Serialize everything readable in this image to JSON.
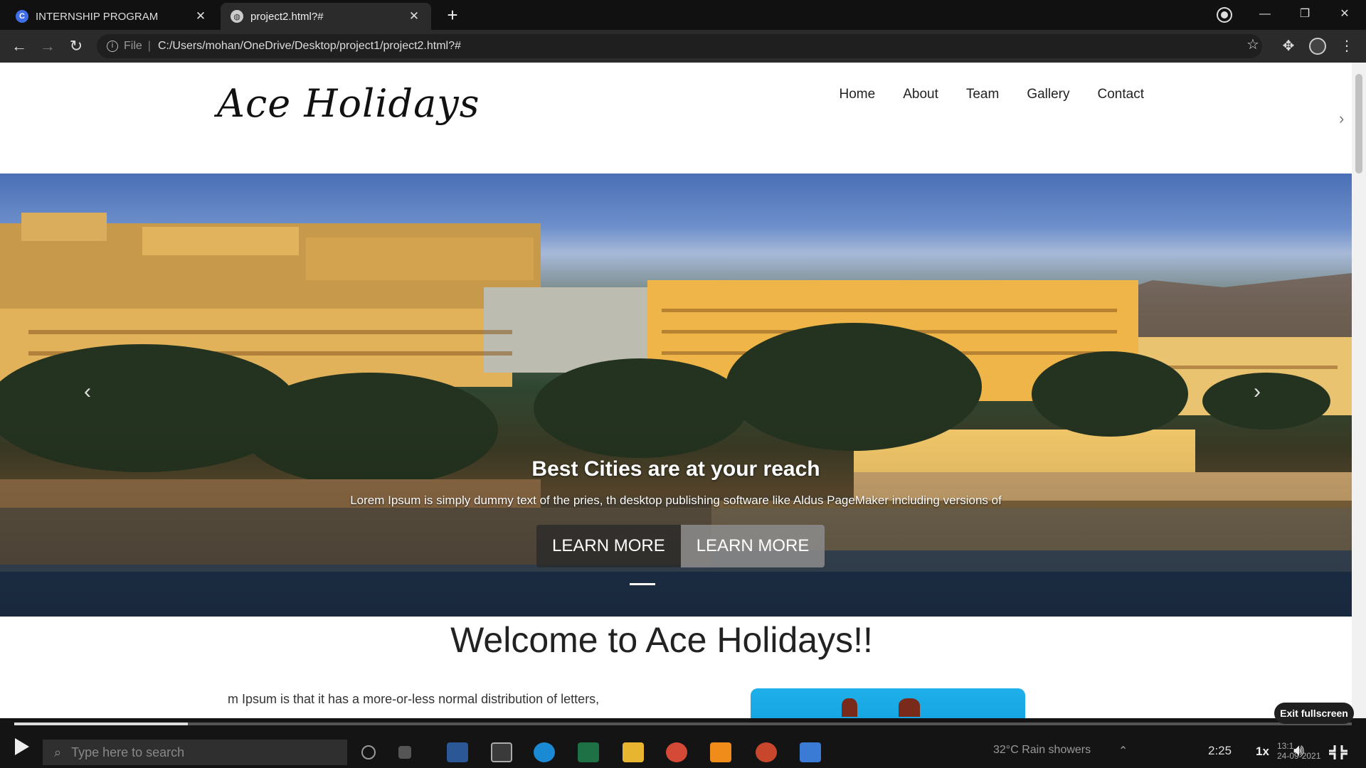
{
  "browser": {
    "tabs": [
      {
        "title": "INTERNSHIP PROGRAM",
        "favicon": "C"
      },
      {
        "title": "project2.html?#"
      }
    ],
    "omnibox": {
      "scheme": "File",
      "url": "C:/Users/mohan/OneDrive/Desktop/project1/project2.html?#"
    }
  },
  "site": {
    "logo": "Ace Holidays",
    "nav": [
      "Home",
      "About",
      "Team",
      "Gallery",
      "Contact"
    ],
    "hero": {
      "title": "Best Cities are at your reach",
      "text": "Lorem Ipsum is simply dummy text of the pries, th desktop publishing software like Aldus PageMaker including versions of",
      "buttons": [
        "LEARN MORE",
        "LEARN MORE"
      ]
    },
    "welcome": "Welcome to Ace Holidays!!",
    "about_line1": "m Ipsum is that it has a more-or-less normal distribution of letters,"
  },
  "player": {
    "progress": 0.13,
    "time": "2:25",
    "speed": "1x",
    "tooltip": "Exit fullscreen"
  },
  "taskbar": {
    "search_placeholder": "Type here to search",
    "weather": "32°C  Rain showers",
    "clock_time": "13:1",
    "clock_date": "24-09-2021"
  },
  "colors": {
    "accent_blue": "#1fb0ea",
    "hero_sky": "#4b6fb6"
  }
}
